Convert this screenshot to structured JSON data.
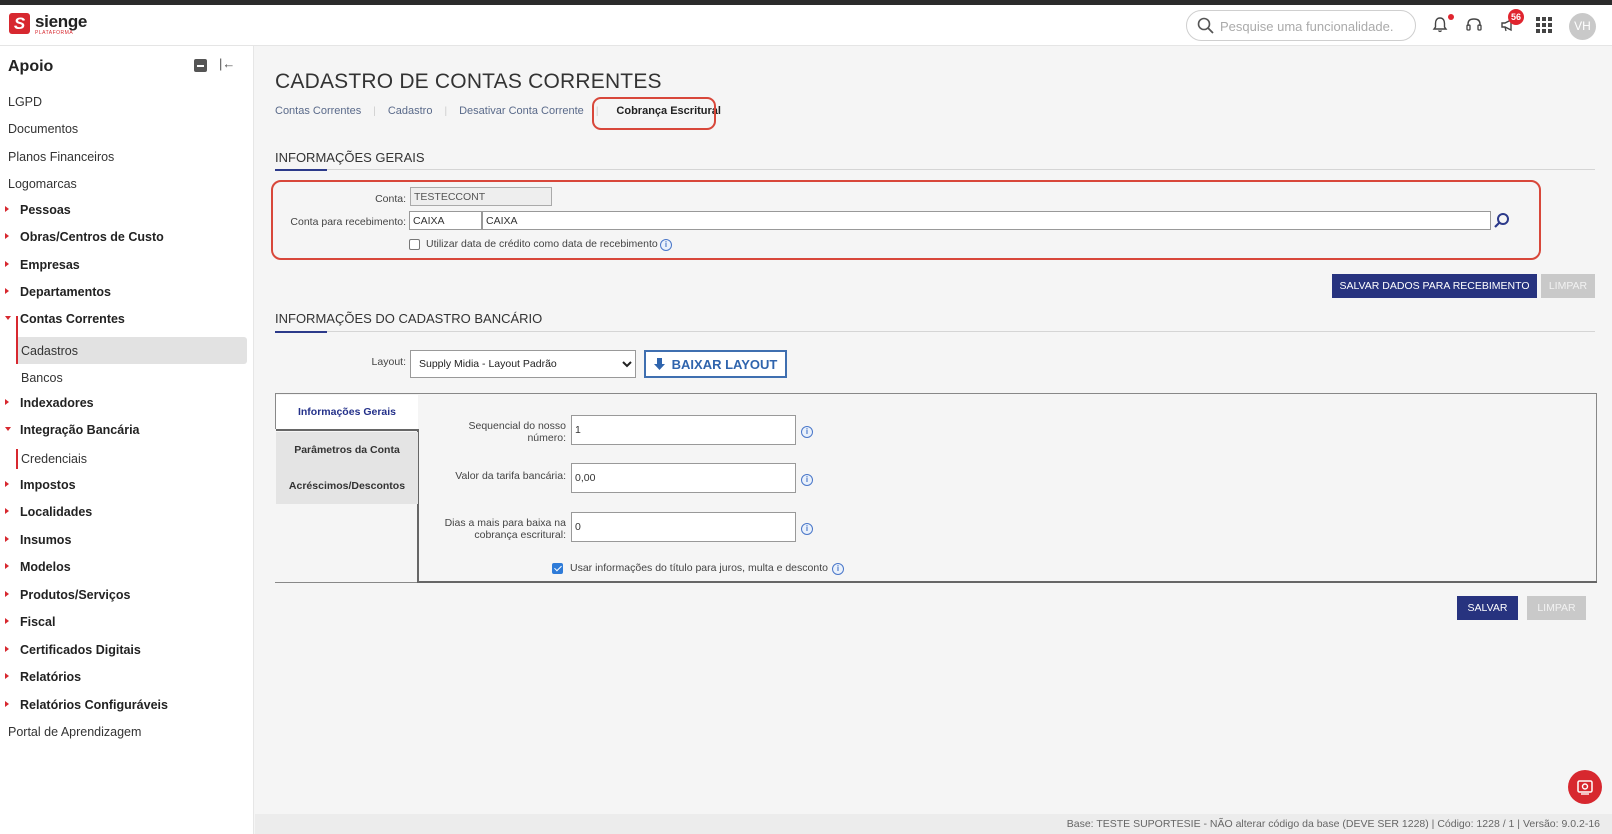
{
  "header": {
    "logo_name": "sienge",
    "logo_sub": "PLATAFORMA",
    "search_placeholder": "Pesquise uma funcionalidade.",
    "badge_count": "56",
    "avatar_initials": "VH"
  },
  "sidebar": {
    "title": "Apoio",
    "items": [
      {
        "label": "LGPD"
      },
      {
        "label": "Documentos"
      },
      {
        "label": "Planos Financeiros"
      },
      {
        "label": "Logomarcas"
      },
      {
        "label": "Pessoas"
      },
      {
        "label": "Obras/Centros de Custo"
      },
      {
        "label": "Empresas"
      },
      {
        "label": "Departamentos"
      },
      {
        "label": "Contas Correntes"
      },
      {
        "label": "Cadastros"
      },
      {
        "label": "Bancos"
      },
      {
        "label": "Indexadores"
      },
      {
        "label": "Integração Bancária"
      },
      {
        "label": "Credenciais"
      },
      {
        "label": "Impostos"
      },
      {
        "label": "Localidades"
      },
      {
        "label": "Insumos"
      },
      {
        "label": "Modelos"
      },
      {
        "label": "Produtos/Serviços"
      },
      {
        "label": "Fiscal"
      },
      {
        "label": "Certificados Digitais"
      },
      {
        "label": "Relatórios"
      },
      {
        "label": "Relatórios Configuráveis"
      },
      {
        "label": "Portal de Aprendizagem"
      }
    ]
  },
  "main": {
    "title": "CADASTRO DE CONTAS CORRENTES",
    "breadcrumb": [
      "Contas Correntes",
      "Cadastro",
      "Desativar Conta Corrente",
      "Cobrança Escritural"
    ],
    "general": {
      "section_title": "INFORMAÇÕES GERAIS",
      "conta_label": "Conta:",
      "conta_value": "TESTECCONT",
      "recebimento_label": "Conta para recebimento:",
      "recebimento_code": "CAIXA",
      "recebimento_name": "CAIXA",
      "credito_checkbox_label": "Utilizar data de crédito como data de recebimento",
      "credito_checked": false,
      "save_button": "SALVAR DADOS PARA RECEBIMENTO",
      "clear_button": "LIMPAR"
    },
    "bank": {
      "section_title": "INFORMAÇÕES DO CADASTRO BANCÁRIO",
      "layout_label": "Layout:",
      "layout_value": "Supply Midia - Layout Padrão",
      "download_button": "BAIXAR LAYOUT",
      "tabs": [
        {
          "label": "Informações Gerais",
          "active": true
        },
        {
          "label": "Parâmetros da Conta",
          "active": false
        },
        {
          "label": "Acréscimos/Descontos",
          "active": false
        }
      ],
      "fields": {
        "sequencial_label_1": "Sequencial do nosso",
        "sequencial_label_2": "número:",
        "sequencial_value": "1",
        "tarifa_label": "Valor da tarifa bancária:",
        "tarifa_value": "0,00",
        "dias_label_1": "Dias a mais para baixa na",
        "dias_label_2": "cobrança escritural:",
        "dias_value": "0",
        "usar_info_label": "Usar informações do título para juros, multa e desconto",
        "usar_info_checked": true
      },
      "save_button": "SALVAR",
      "clear_button": "LIMPAR"
    }
  },
  "footer": {
    "text": "Base: TESTE SUPORTESIE - NÃO alterar código da base (DEVE SER 1228)  |  Código: 1228 / 1  |  Versão: 9.0.2-16"
  },
  "colors": {
    "brand_red": "#d7282f",
    "primary_navy": "#27337f",
    "highlight_red": "#d8473a"
  }
}
